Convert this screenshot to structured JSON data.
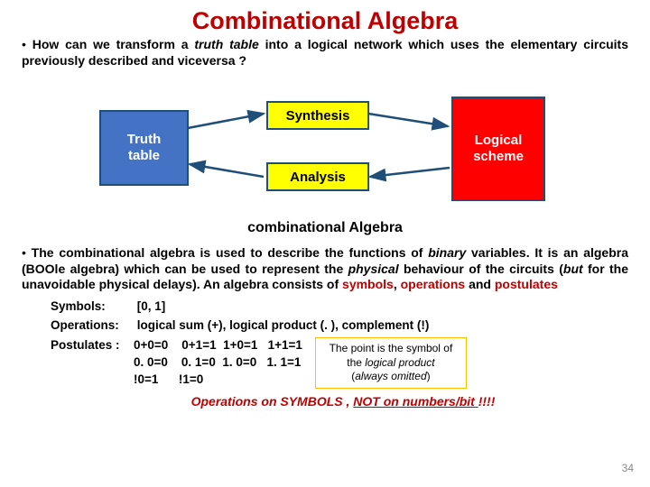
{
  "title": "Combinational Algebra",
  "bullet1": {
    "pre": "How can we transform a ",
    "truth": "truth table",
    "post": " into a logical network which uses the elementary circuits previously described and viceversa ?"
  },
  "diagram": {
    "truth_table": "Truth\ntable",
    "synthesis": "Synthesis",
    "analysis": "Analysis",
    "logical_scheme": "Logical\nscheme"
  },
  "combolabel": "combinational Algebra",
  "para": {
    "t1": "The combinational algebra is used to describe the functions of ",
    "binary": "binary",
    "t2": " variables. It is an algebra (BOOle algebra) which can be used to represent the ",
    "physical": "physical",
    "t3": " behaviour of the circuits (",
    "but": "but",
    "t4": " for the unavoidable physical delays). An algebra consists of ",
    "symbols": "symbols",
    "comma1": ",  ",
    "operations": "operations",
    "and": " and ",
    "postulates": "postulates"
  },
  "defs": {
    "symbols_label": "Symbols:",
    "symbols_val": "[0, 1]",
    "operations_label": "Operations:",
    "operations_val": "logical sum (+), logical product (. ),  complement (!)",
    "postulates_label": "Postulates :",
    "postulates_val": "0+0=0    0+1=1  1+0=1   1+1=1\n0. 0=0    0. 1=0  1. 0=0   1. 1=1\n!0=1      !1=0"
  },
  "notebox": {
    "l1": "The point is the symbol of the ",
    "logical_product": "logical product",
    "l2": "(",
    "always_omitted": "always omitted",
    "l3": ")"
  },
  "footer": {
    "pre": "Operations on SYMBOLS , ",
    "underline": "NOT on numbers/bit ",
    "excl": "!!!!"
  },
  "pagenum": "34"
}
